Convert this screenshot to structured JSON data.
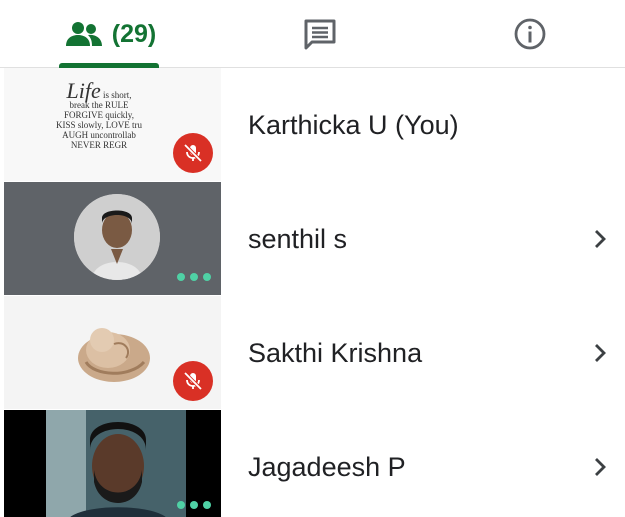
{
  "tabs": {
    "people_count": "(29)",
    "active": "people"
  },
  "participants": [
    {
      "name": "Karthicka U (You)",
      "muted": true,
      "thumb": "quote-image"
    },
    {
      "name": "senthil s",
      "muted": false,
      "thumb": "avatar-photo"
    },
    {
      "name": "Sakthi Krishna",
      "muted": true,
      "thumb": "avatar-image"
    },
    {
      "name": "Jagadeesh P",
      "muted": false,
      "thumb": "video"
    }
  ],
  "quote_image": {
    "line1": "is short,",
    "line2": "break the RULE",
    "line3": "FORGIVE quickly,",
    "line4": "KISS slowly, LOVE tru",
    "line5": "AUGH uncontrollab",
    "line6": "NEVER REGR",
    "big": "Life"
  },
  "colors": {
    "accent": "#137333",
    "mute": "#d93025",
    "dots": "#4fd1a5"
  },
  "icons": {
    "people": "people-icon",
    "chat": "chat-icon",
    "info": "info-icon",
    "chevron": "chevron-right-icon",
    "mic_off": "mic-off-icon",
    "more": "more-dots-icon"
  }
}
